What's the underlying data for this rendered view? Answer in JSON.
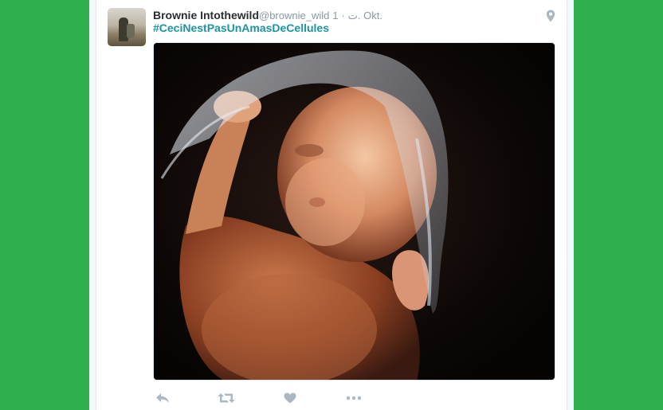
{
  "tweet": {
    "author_name": "Brownie Intothewild",
    "author_handle": "@brownie_wild",
    "verified_glyph": "ت",
    "separator": "·",
    "timestamp": "1. Okt.",
    "text": "#CeciNestPasUnAmasDeCellules"
  },
  "icons": {
    "location": "location-pin-icon",
    "reply": "reply-icon",
    "retweet": "retweet-icon",
    "like": "heart-icon",
    "more": "more-dots-icon"
  },
  "colors": {
    "page_background": "#2db04b",
    "hashtag": "#1b95a3",
    "muted": "#8899a6",
    "action_icons": "#aab8c2"
  }
}
